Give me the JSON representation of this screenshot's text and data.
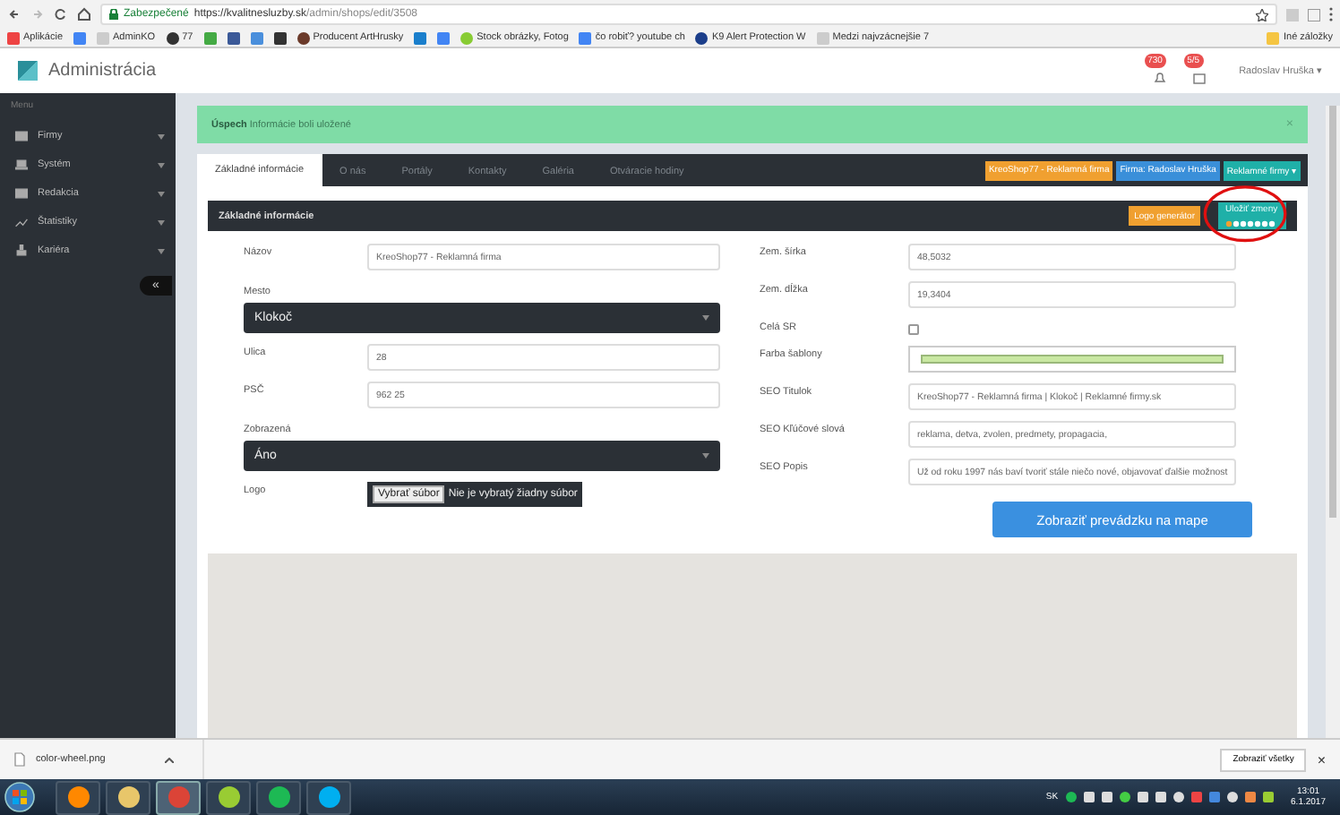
{
  "browser": {
    "secure_label": "Zabezpečené",
    "url_host": "https://kvalitnesluzby.sk",
    "url_path": "/admin/shops/edit/3508"
  },
  "bookmarks": [
    {
      "kind": "link",
      "label": "Aplikácie"
    },
    {
      "kind": "icon"
    },
    {
      "kind": "link",
      "label": "AdminKO"
    },
    {
      "kind": "link",
      "label": "77"
    },
    {
      "kind": "icon"
    },
    {
      "kind": "icon"
    },
    {
      "kind": "icon"
    },
    {
      "kind": "icon"
    },
    {
      "kind": "link",
      "label": "Producent ArtHrusky"
    },
    {
      "kind": "icon"
    },
    {
      "kind": "icon"
    },
    {
      "kind": "link",
      "label": "Stock obrázky, Fotog"
    },
    {
      "kind": "link",
      "label": "čo robiť? youtube ch"
    },
    {
      "kind": "link",
      "label": "K9 Alert Protection W"
    },
    {
      "kind": "link",
      "label": "Medzi najvzácnejšie 7"
    }
  ],
  "other_bookmarks": "Iné záložky",
  "header": {
    "title": "Administrácia",
    "notifications": "730",
    "messages": "5/5",
    "user": "Radoslav Hruška",
    "user_caret": "▾"
  },
  "sidebar": {
    "heading": "Menu",
    "items": [
      {
        "label": "Firmy"
      },
      {
        "label": "Systém"
      },
      {
        "label": "Redakcia"
      },
      {
        "label": "Štatistiky"
      },
      {
        "label": "Kariéra"
      }
    ],
    "collapse": "«"
  },
  "alert": {
    "text": "**Úspech** Informácie boli uložené",
    "close": "×"
  },
  "tabs": [
    {
      "label": "Základné informácie",
      "selected": true
    },
    {
      "label": "O nás",
      "selected": false
    },
    {
      "label": "Portály",
      "selected": false
    },
    {
      "label": "Kontakty",
      "selected": false
    },
    {
      "label": "Galéria",
      "selected": false
    },
    {
      "label": "Otváracie hodiny",
      "selected": false
    }
  ],
  "tags": [
    {
      "label": "KreoShop77 - Reklamná firma",
      "color": "#f0a030"
    },
    {
      "label": "Firma: Radoslav Hruška",
      "color": "#3a8fd9"
    },
    {
      "label": "Reklamné firmy ▾",
      "color": "#1fb0a8"
    }
  ],
  "panel": {
    "title": "Základné informácie",
    "logo_button": "Logo generátor",
    "save_button": "Uložiť zmeny"
  },
  "left_fields": [
    {
      "kind": "input",
      "label": "Názov",
      "value": "KreoShop77 - Reklamná firma"
    },
    {
      "kind": "select",
      "label": "Mesto",
      "value": "Klokoč"
    },
    {
      "kind": "input",
      "label": "Ulica",
      "value": "28"
    },
    {
      "kind": "input",
      "label": "PSČ",
      "value": "962 25"
    },
    {
      "kind": "select",
      "label": "Zobrazená",
      "value": "Áno"
    },
    {
      "kind": "file",
      "label": "Logo",
      "button": "Vybrať súbor",
      "value": "Nie je vybratý žiadny súbor"
    }
  ],
  "right_fields": [
    {
      "kind": "input",
      "label": "Zem. šírka",
      "value": "48,5032"
    },
    {
      "kind": "input",
      "label": "Zem. dĺžka",
      "value": "19,3404"
    },
    {
      "kind": "checkbox",
      "label": "Celá SR",
      "checked": false
    },
    {
      "kind": "color",
      "label": "Farba šablony",
      "color": "#c9e8a2"
    },
    {
      "kind": "input",
      "label": "SEO Titulok",
      "value": "KreoShop77 - Reklamná firma | Klokoč | Reklamné firmy.sk"
    },
    {
      "kind": "input",
      "label": "SEO Kľúčové slová",
      "value": "reklama, detva, zvolen, predmety, propagacia,"
    },
    {
      "kind": "input",
      "label": "SEO Popis",
      "value": "Už od roku 1997 nás baví tvoriť stále niečo nové, objavovať ďalšie možnost"
    }
  ],
  "map_button": "Zobraziť prevádzku na mape",
  "download": {
    "file": "color-wheel.png",
    "show_all": "Zobraziť všetky",
    "close": "×"
  },
  "taskbar": {
    "apps": [
      {
        "active": false
      },
      {
        "active": false
      },
      {
        "active": true
      },
      {
        "active": false
      },
      {
        "active": false
      },
      {
        "active": false
      }
    ],
    "language": "SK",
    "time": "13:01",
    "date": "6.1.2017"
  }
}
